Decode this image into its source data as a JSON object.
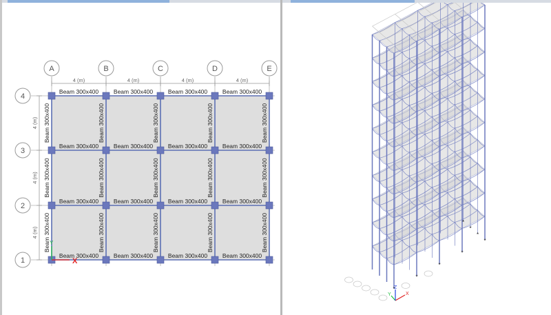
{
  "plan_view": {
    "grid_x": [
      "A",
      "B",
      "C",
      "D",
      "E"
    ],
    "grid_y": [
      "1",
      "2",
      "3",
      "4"
    ],
    "spacing_label": "4 (m)",
    "beam_label": "Beam 300x400",
    "axis_x_label": "X",
    "axis_y_label": "Y"
  },
  "view3d": {
    "axis_x_label": "X",
    "axis_y_label": "Y",
    "axis_z_label": "Z",
    "stories": 10
  },
  "colors": {
    "beam": "#5b6fb3",
    "column": "#6b78bd",
    "slab": "#dedede",
    "grid_bubble": "#9a9a9a",
    "axis_x": "#e02020",
    "axis_y": "#20c040",
    "axis_z": "#2040e0"
  }
}
